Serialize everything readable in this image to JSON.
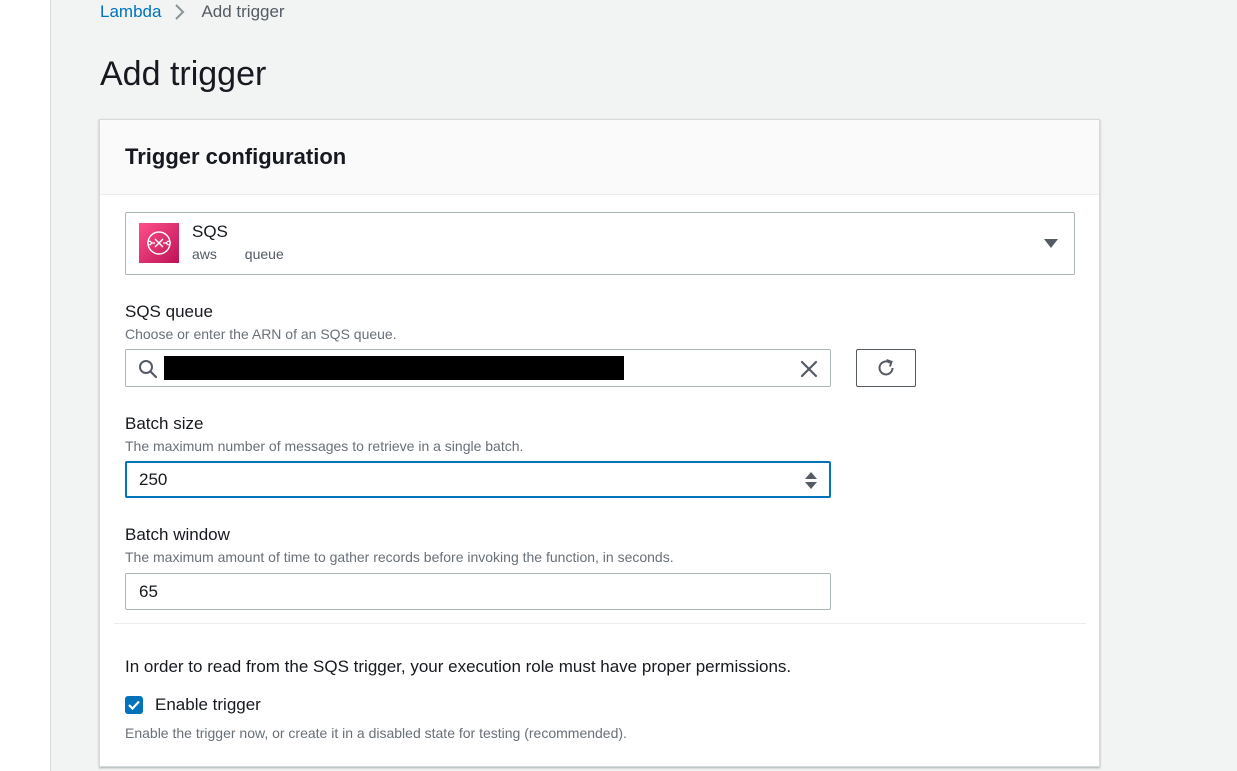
{
  "breadcrumb": {
    "items": [
      "Lambda",
      "Add trigger"
    ]
  },
  "page": {
    "title": "Add trigger"
  },
  "trigger_config": {
    "title": "Trigger configuration",
    "source": {
      "name": "SQS",
      "tags": [
        "aws",
        "queue"
      ],
      "icon": "sqs-icon"
    },
    "sqs_queue": {
      "label": "SQS queue",
      "description": "Choose or enter the ARN of an SQS queue.",
      "value_redacted": true
    },
    "batch_size": {
      "label": "Batch size",
      "description": "The maximum number of messages to retrieve in a single batch.",
      "value": "250"
    },
    "batch_window": {
      "label": "Batch window",
      "description": "The maximum amount of time to gather records before invoking the function, in seconds.",
      "value": "65"
    },
    "permission_note": "In order to read from the SQS trigger, your execution role must have proper permissions.",
    "enable_trigger": {
      "label": "Enable trigger",
      "checked": true,
      "description": "Enable the trigger now, or create it in a disabled state for testing (recommended)."
    }
  },
  "colors": {
    "link": "#0073bb",
    "focus_border": "#0073bb",
    "checkbox": "#0073bb",
    "sqs_brand": "#e7157b",
    "page_background": "#f2f3f3"
  }
}
